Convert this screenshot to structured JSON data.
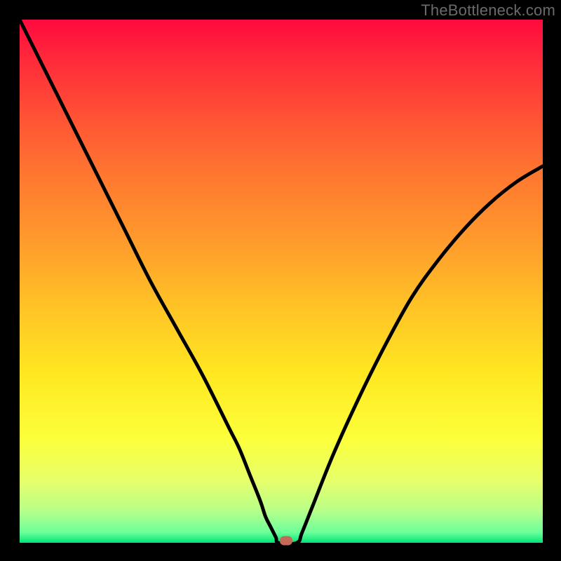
{
  "watermark_text": "TheBottleneck.com",
  "colors": {
    "frame": "#000000",
    "curve": "#000000",
    "marker": "#c56a5a",
    "gradient_top": "#ff0a3e",
    "gradient_bottom": "#00e676"
  },
  "chart_data": {
    "type": "line",
    "title": "",
    "xlabel": "",
    "ylabel": "",
    "xlim": [
      0,
      100
    ],
    "ylim": [
      0,
      100
    ],
    "x": [
      0,
      5,
      10,
      15,
      20,
      25,
      30,
      35,
      40,
      42,
      44,
      46,
      47,
      48,
      49,
      49.5,
      53,
      54,
      56,
      60,
      65,
      70,
      75,
      80,
      85,
      90,
      95,
      100
    ],
    "y": [
      100,
      90,
      80,
      70,
      60,
      50,
      41,
      32,
      22,
      18,
      13,
      8,
      5,
      3,
      1,
      0,
      0,
      2,
      7,
      17,
      28,
      38,
      47,
      54,
      60,
      65,
      69,
      72
    ],
    "notes": "V-shaped bottleneck curve on rainbow gradient background; minimum (optimal point) at approximately x=51. Curve left branch starts at top-left corner (x=0,y=100) descending roughly linearly to the trough; right branch rises with decreasing slope toward (x=100,y≈72).",
    "marker": {
      "x": 51,
      "y": 0,
      "label": "optimal-point"
    }
  }
}
